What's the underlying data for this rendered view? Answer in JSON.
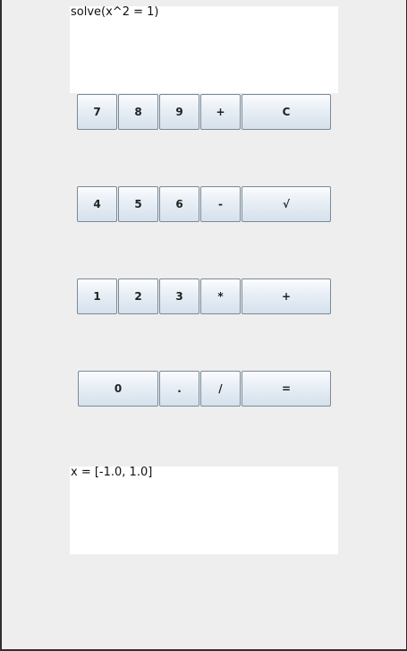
{
  "input_text": "solve(x^2 = 1)",
  "output_text": "x = [-1.0, 1.0]",
  "buttons": {
    "seven": "7",
    "eight": "8",
    "nine": "9",
    "plus_top": "+",
    "clear": "C",
    "four": "4",
    "five": "5",
    "six": "6",
    "minus": "-",
    "sqrt": "√",
    "one": "1",
    "two": "2",
    "three": "3",
    "multiply": "*",
    "plus": "+",
    "zero": "0",
    "dot": ".",
    "divide": "/",
    "equals": "="
  }
}
